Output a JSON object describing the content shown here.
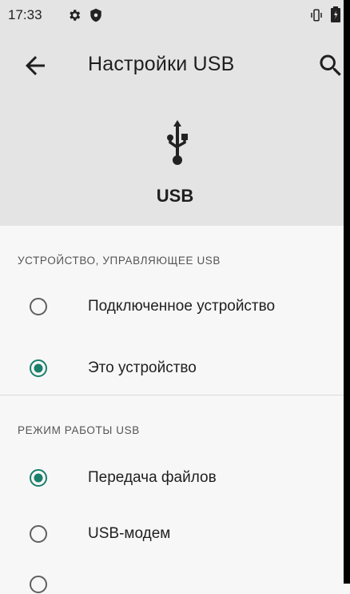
{
  "status_bar": {
    "time": "17:33",
    "icons": [
      "gear-icon",
      "shield-icon",
      "vibrate-icon",
      "battery-icon"
    ]
  },
  "toolbar": {
    "title": "Настройки USB",
    "back_icon": "arrow-back-icon",
    "search_icon": "search-icon"
  },
  "hero": {
    "icon": "usb-icon",
    "label": "USB"
  },
  "sections": [
    {
      "header": "УСТРОЙСТВО, УПРАВЛЯЮЩЕЕ USB",
      "options": [
        {
          "label": "Подключенное устройство",
          "selected": false
        },
        {
          "label": "Это устройство",
          "selected": true
        }
      ]
    },
    {
      "header": "РЕЖИМ РАБОТЫ USB",
      "options": [
        {
          "label": "Передача файлов",
          "selected": true
        },
        {
          "label": "USB-модем",
          "selected": false
        }
      ]
    }
  ],
  "colors": {
    "accent": "#1a7f6b",
    "header_bg": "#e4e4e4",
    "page_bg": "#f7f7f7",
    "radio_off": "#5f5f5f"
  }
}
